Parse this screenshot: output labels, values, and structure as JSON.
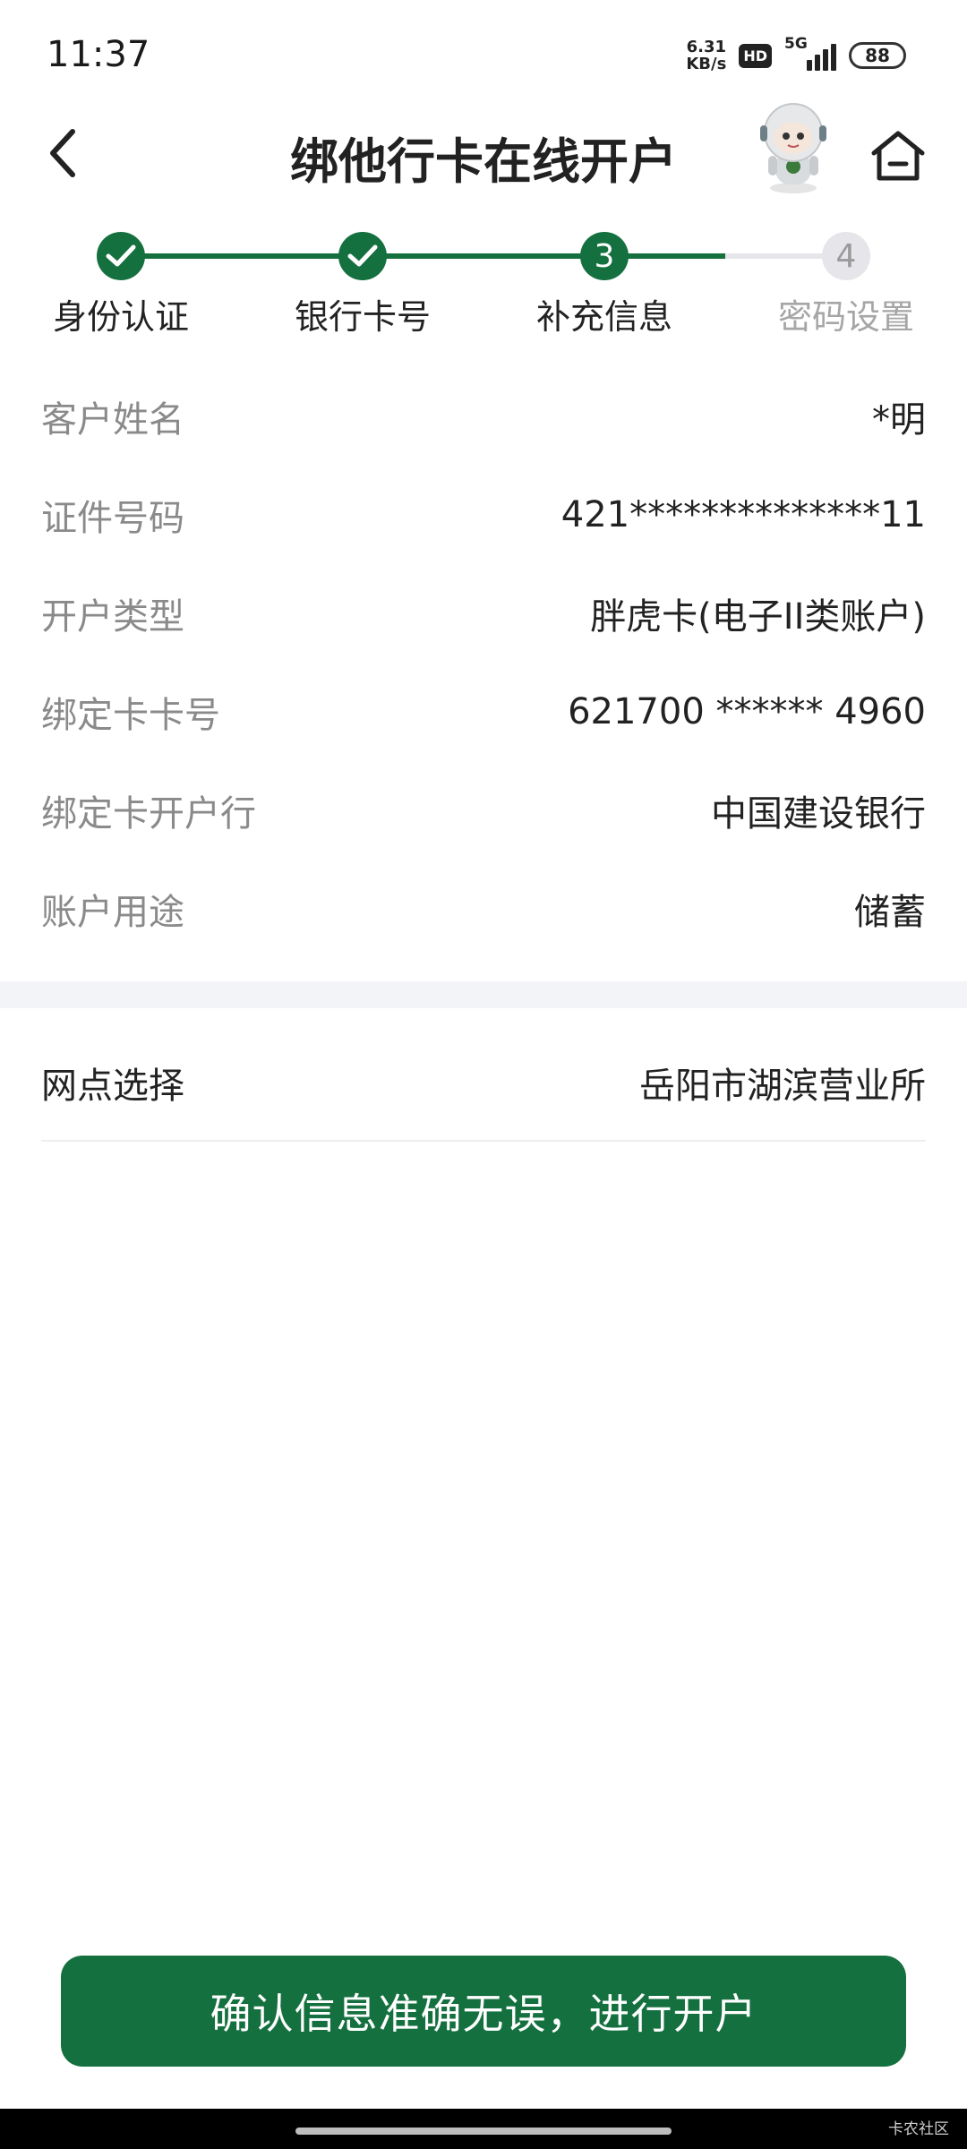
{
  "status_bar": {
    "time": "11:37",
    "net_speed_value": "6.31",
    "net_speed_unit": "KB/s",
    "hd": "HD",
    "network": "5G",
    "battery": "88"
  },
  "header": {
    "title": "绑他行卡在线开户",
    "back_icon": "chevron-left-icon",
    "home_icon": "home-icon",
    "avatar_icon": "robot-assistant-icon"
  },
  "stepper": {
    "current_step": 3,
    "steps": [
      {
        "label": "身份认证",
        "state": "done"
      },
      {
        "label": "银行卡号",
        "state": "done"
      },
      {
        "number": "3",
        "label": "补充信息",
        "state": "current"
      },
      {
        "number": "4",
        "label": "密码设置",
        "state": "pending"
      }
    ]
  },
  "info": [
    {
      "label": "客户姓名",
      "value": "*明"
    },
    {
      "label": "证件号码",
      "value": "421**************11"
    },
    {
      "label": "开户类型",
      "value": "胖虎卡(电子II类账户)"
    },
    {
      "label": "绑定卡卡号",
      "value": "621700 ****** 4960"
    },
    {
      "label": "绑定卡开户行",
      "value": "中国建设银行"
    },
    {
      "label": "账户用途",
      "value": "储蓄"
    }
  ],
  "branch": {
    "label": "网点选择",
    "value": "岳阳市湖滨营业所"
  },
  "confirm_button": "确认信息准确无误，进行开户",
  "watermark": "卡农社区",
  "colors": {
    "brand_green": "#15703f",
    "pending_gray": "#e6e6ea",
    "label_gray": "#8a8a8a"
  }
}
